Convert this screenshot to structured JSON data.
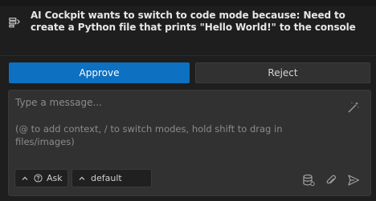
{
  "approval": {
    "message": "AI Cockpit wants to switch to code mode because: Need to create a Python file that prints \"Hello World!\" to the console",
    "approve_label": "Approve",
    "reject_label": "Reject"
  },
  "composer": {
    "placeholder_title": "Type a message...",
    "placeholder_hint": "(@ to add context, / to switch modes, hold shift to drag in files/images)",
    "mode_label": "Ask",
    "profile_label": "default"
  },
  "icons": {
    "notice": "switch-mode-icon",
    "enhance": "magic-wand-icon",
    "mode_help": "question-circle-icon",
    "context": "database-icon",
    "attach": "paperclip-icon",
    "send": "send-icon",
    "chevron": "chevron-up-icon"
  },
  "colors": {
    "approve_bg": "#0e70c0",
    "panel_bg": "#1e1e1e",
    "composer_bg": "#313131"
  }
}
